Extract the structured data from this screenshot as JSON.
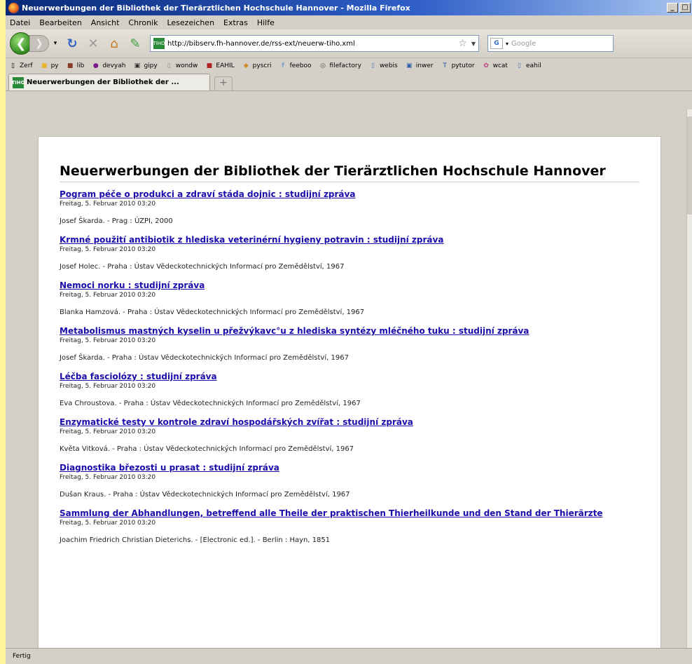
{
  "window": {
    "title": "Neuerwerbungen der Bibliothek der Tierärztlichen Hochschule Hannover - Mozilla Firefox"
  },
  "menu": [
    "Datei",
    "Bearbeiten",
    "Ansicht",
    "Chronik",
    "Lesezeichen",
    "Extras",
    "Hilfe"
  ],
  "navbar": {
    "url": "http://bibserv.fh-hannover.de/rss-ext/neuerw-tiho.xml",
    "search_placeholder": "Google",
    "site_icon_text": "TIHO",
    "engine_icon_text": "G"
  },
  "bookmarks": [
    "Zerf",
    "py",
    "lib",
    "devyah",
    "gipy",
    "wondw",
    "EAHIL",
    "pyscri",
    "feeboo",
    "filefactory",
    "webis",
    "inwer",
    "pytutor",
    "wcat",
    "eahil"
  ],
  "tab": {
    "label": "Neuerwerbungen der Bibliothek der ...",
    "new_tab_glyph": "+"
  },
  "page": {
    "title": "Neuerwerbungen der Bibliothek der Tierärztlichen Hochschule Hannover",
    "items": [
      {
        "title": "Pogram péče o produkci a zdraví stáda dojnic : studijní zpráva",
        "date": "Freitag, 5. Februar 2010 03:20",
        "desc": "Josef Škarda. - Prag : ÚZPI, 2000"
      },
      {
        "title": "Krmné použití antibiotik z hlediska veterinérní hygieny potravin : studijní zpráva",
        "date": "Freitag, 5. Februar 2010 03:20",
        "desc": "Josef Holec. - Praha : Ústav Vědeckotechnických Informací pro Zemědělství, 1967"
      },
      {
        "title": "Nemoci norku : studijní zpráva",
        "date": "Freitag, 5. Februar 2010 03:20",
        "desc": "Blanka Hamzová. - Praha : Ústav Vědeckotechnických Informací pro Zemědělství, 1967"
      },
      {
        "title": "Metabolismus mastných kyselin u přežvýkavc°u z hlediska syntézy mléčného tuku : studijní zpráva",
        "date": "Freitag, 5. Februar 2010 03:20",
        "desc": "Josef Škarda. - Praha : Ústav Vědeckotechnických Informací pro Zemědělství, 1967"
      },
      {
        "title": "Léčba fasciolózy : studijní zpráva",
        "date": "Freitag, 5. Februar 2010 03:20",
        "desc": "Eva Chroustova. - Praha : Ústav Vědeckotechnických Informací pro Zemědělství, 1967"
      },
      {
        "title": "Enzymatické testy v kontrole zdraví hospodářských zvířat : studijní zpráva",
        "date": "Freitag, 5. Februar 2010 03:20",
        "desc": "Květa Vitková. - Praha : Ústav Vědeckotechnických Informací pro Zemědělství, 1967"
      },
      {
        "title": "Diagnostika březosti u prasat : studijní zpráva",
        "date": "Freitag, 5. Februar 2010 03:20",
        "desc": "Dušan Kraus. - Praha : Ústav Vědeckotechnických Informací pro Zemědělství, 1967"
      },
      {
        "title": "Sammlung der Abhandlungen, betreffend alle Theile der praktischen Thierheilkunde und den Stand der Thierärzte",
        "date": "Freitag, 5. Februar 2010 03:20",
        "desc": "Joachim Friedrich Christian Dieterichs. - [Electronic ed.]. - Berlin : Hayn, 1851"
      }
    ]
  },
  "status": {
    "text": "Fertig"
  }
}
